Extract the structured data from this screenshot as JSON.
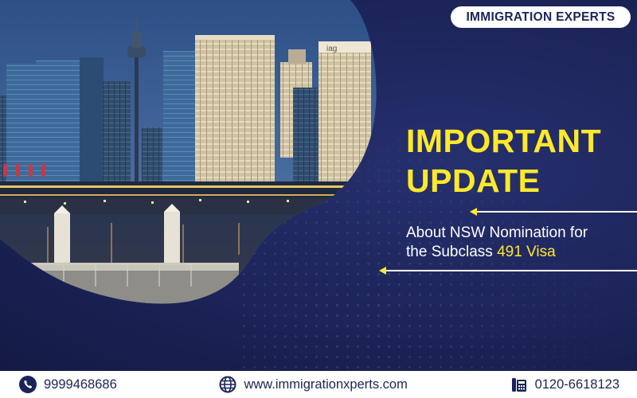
{
  "brand": {
    "name": "IMMIGRATION EXPERTS"
  },
  "headline": {
    "line1": "IMPORTANT",
    "line2": "UPDATE"
  },
  "subtitle": {
    "line1": "About NSW Nomination for",
    "line2_prefix": "the Subclass ",
    "line2_highlight": "491 Visa"
  },
  "photo": {
    "building_sign": "iag"
  },
  "footer": {
    "phone": "9999468686",
    "website": "www.immigrationxperts.com",
    "landline": "0120-6618123"
  },
  "icons": {
    "phone": "phone-icon",
    "website": "globe-icon",
    "landline": "office-phone-icon"
  },
  "colors": {
    "background": "#1b2459",
    "accent": "#ffe92b",
    "text": "#ffffff"
  }
}
